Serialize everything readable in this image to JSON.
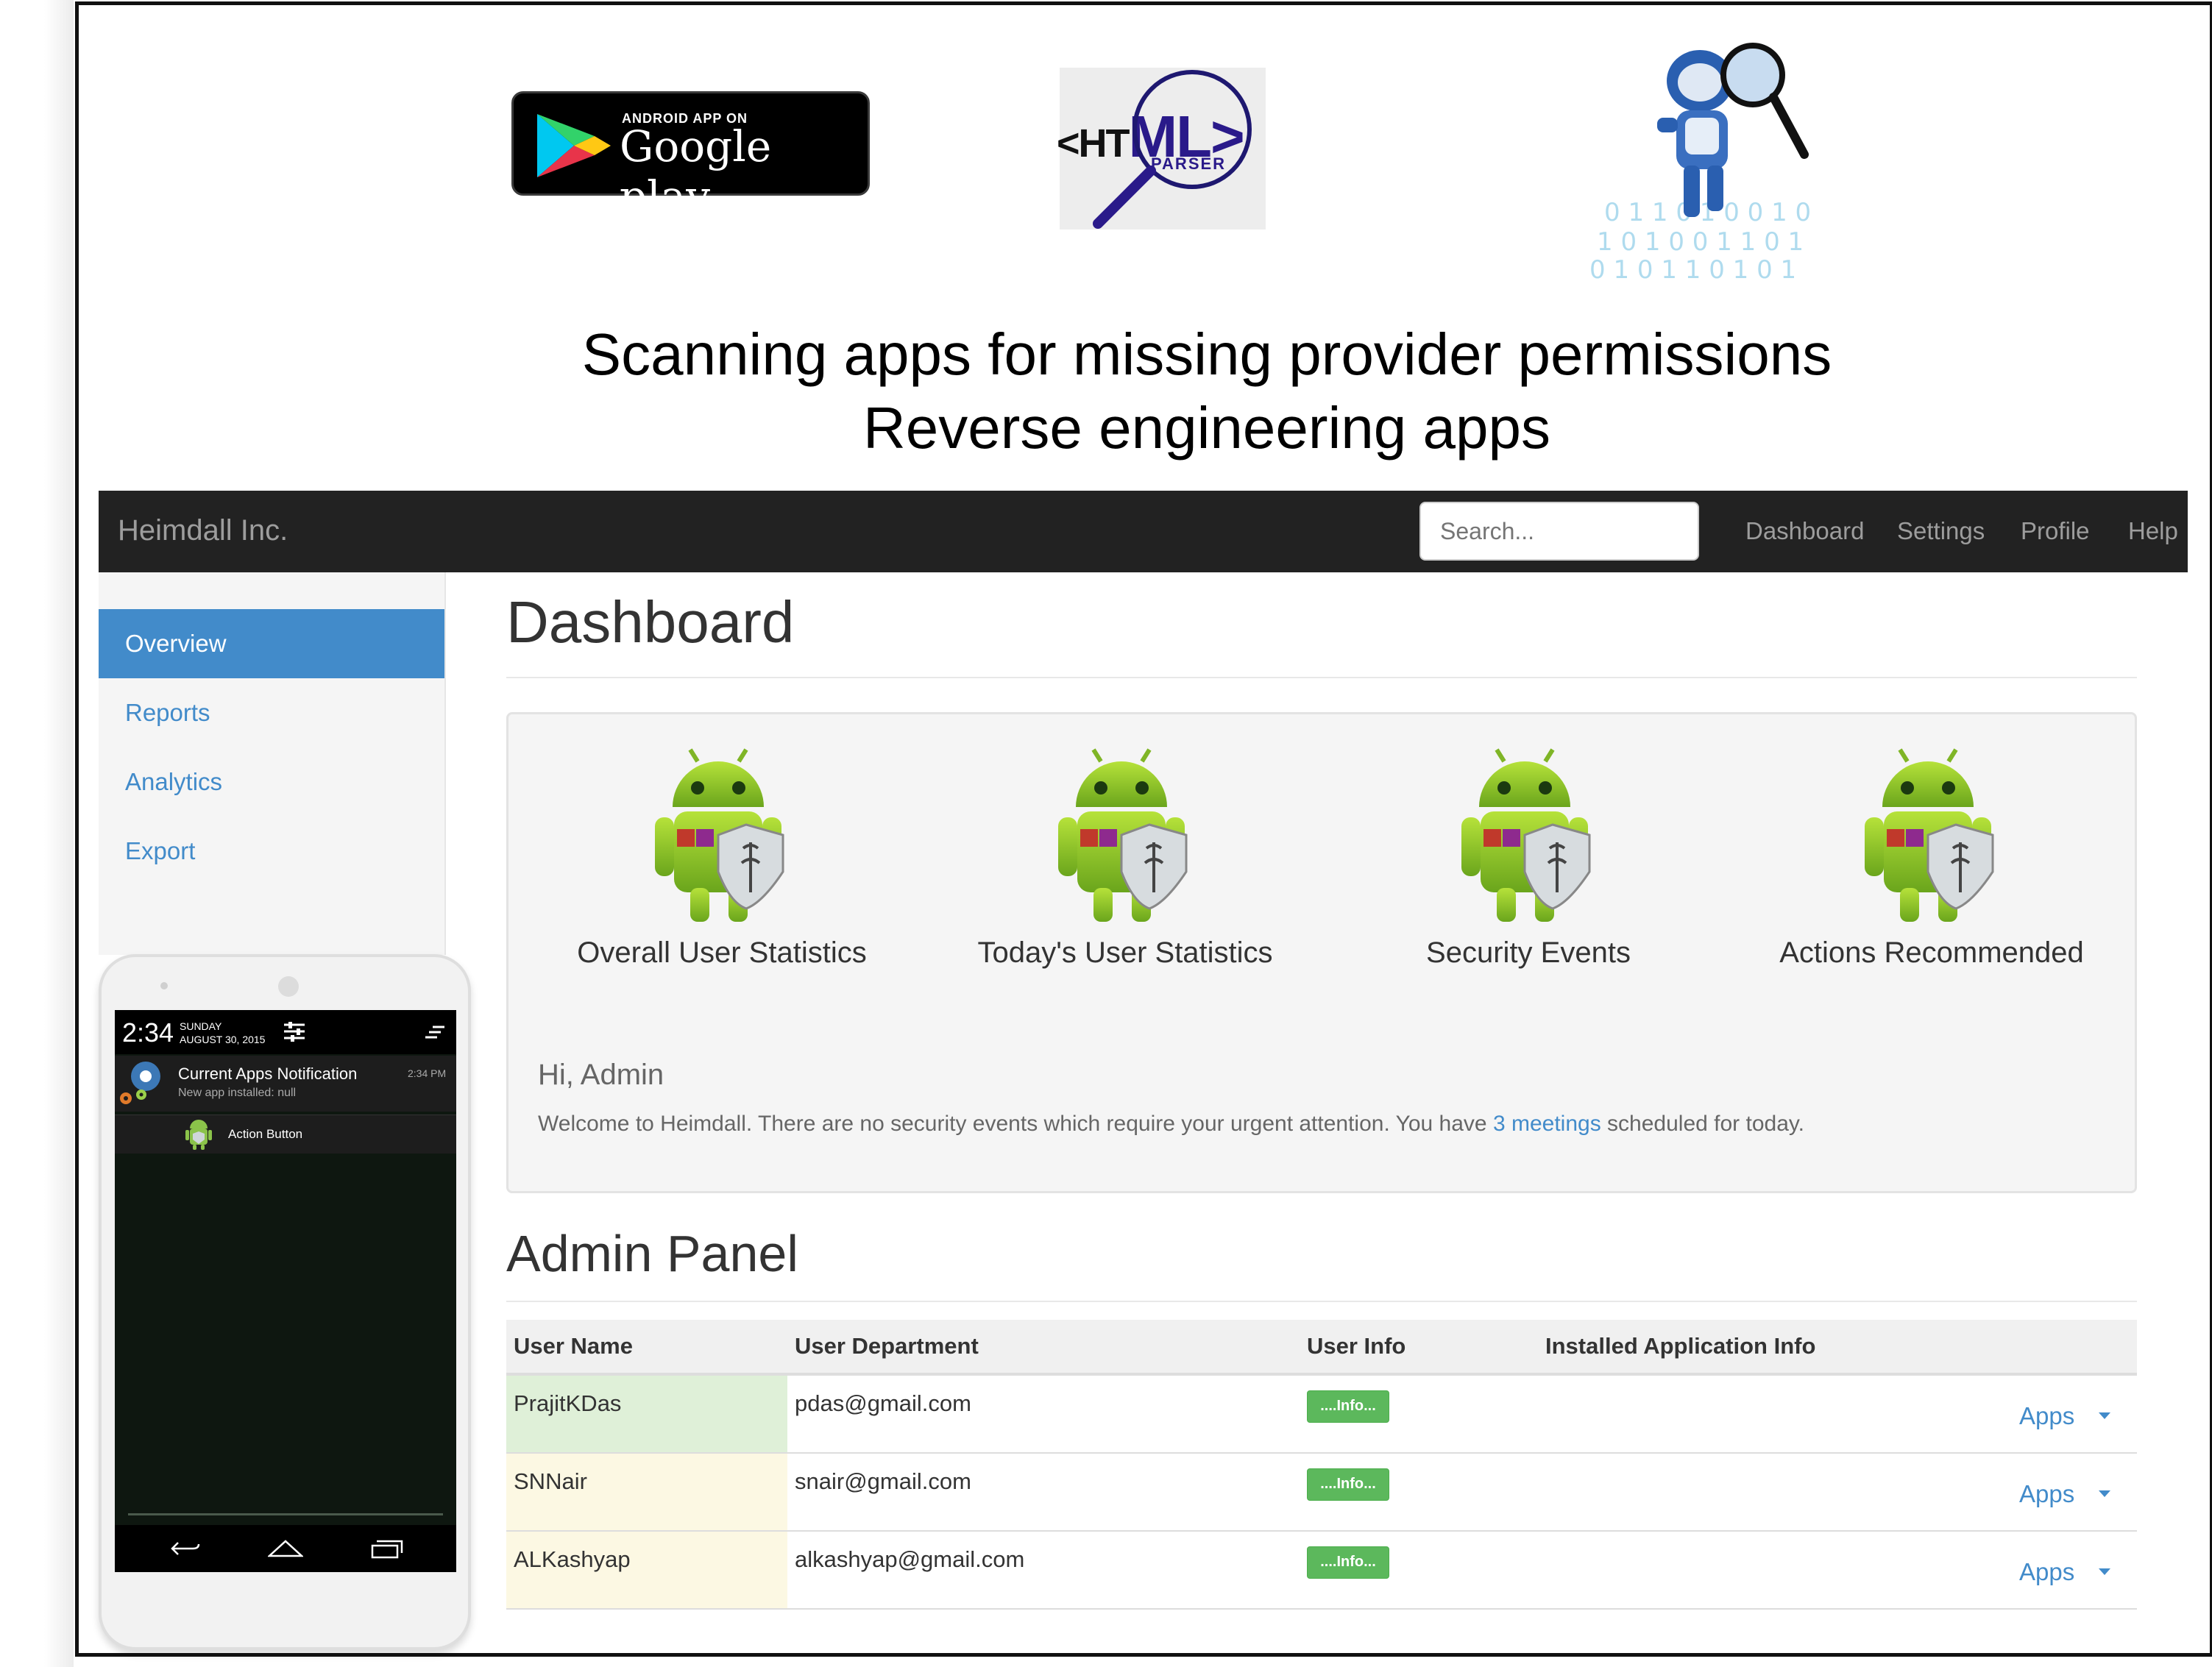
{
  "header": {
    "google_play": {
      "small": "ANDROID APP ON",
      "large": "Google play"
    },
    "html_parser": {
      "tag_open": "<HT",
      "tag_rest": "ML>",
      "sub": "PARSER"
    },
    "headline_line1": "Scanning apps for missing provider permissions",
    "headline_line2": "Reverse engineering apps"
  },
  "navbar": {
    "brand": "Heimdall Inc.",
    "search_placeholder": "Search...",
    "links": [
      "Dashboard",
      "Settings",
      "Profile",
      "Help"
    ]
  },
  "sidebar": {
    "items": [
      {
        "label": "Overview",
        "active": true
      },
      {
        "label": "Reports",
        "active": false
      },
      {
        "label": "Analytics",
        "active": false
      },
      {
        "label": "Export",
        "active": false
      }
    ]
  },
  "phone": {
    "time": "2:34",
    "day": "SUNDAY",
    "date": "AUGUST 30, 2015",
    "notification_title": "Current Apps Notification",
    "notification_sub": "New app installed: null",
    "notification_time": "2:34 PM",
    "action_label": "Action Button"
  },
  "main": {
    "title": "Dashboard",
    "stats": [
      {
        "label": "Overall User Statistics",
        "icon": "android-shield-icon"
      },
      {
        "label": "Today's User Statistics",
        "icon": "android-shield-icon"
      },
      {
        "label": "Security Events",
        "icon": "android-shield-icon"
      },
      {
        "label": "Actions Recommended",
        "icon": "android-shield-icon"
      }
    ],
    "greeting": "Hi, Admin",
    "welcome_pre": "Welcome to Heimdall. There are no security events which require your urgent attention. You have ",
    "welcome_link": "3 meetings",
    "welcome_post": " scheduled for today."
  },
  "admin_panel": {
    "title": "Admin Panel",
    "columns": [
      "User Name",
      "User Department",
      "User Info",
      "Installed Application Info"
    ],
    "rows": [
      {
        "name": "PrajitKDas",
        "department": "pdas@gmail.com",
        "info_label": "....Info...",
        "apps_label": "Apps"
      },
      {
        "name": "SNNair",
        "department": "snair@gmail.com",
        "info_label": "....Info...",
        "apps_label": "Apps"
      },
      {
        "name": "ALKashyap",
        "department": "alkashyap@gmail.com",
        "info_label": "....Info...",
        "apps_label": "Apps"
      }
    ]
  },
  "colors": {
    "accent": "#428bca",
    "navbar": "#222222",
    "success": "#5cb85c",
    "row1_name_bg": "#dff0d8",
    "row_name_bg": "#fcf8e3"
  }
}
